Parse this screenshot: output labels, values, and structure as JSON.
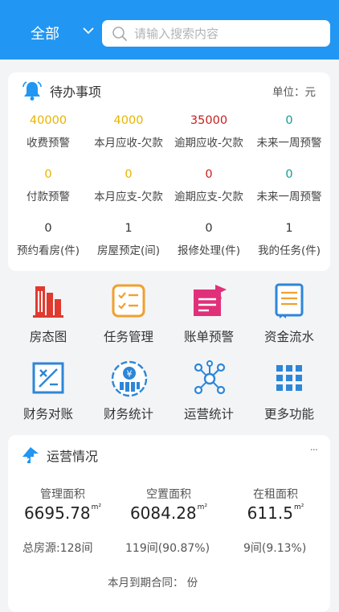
{
  "header": {
    "scope_label": "全部",
    "search_placeholder": "请输入搜索内容"
  },
  "todo": {
    "title": "待办事项",
    "unit": "单位：元",
    "items": [
      {
        "value": "40000",
        "label": "收费预警",
        "color": "#e7b400"
      },
      {
        "value": "4000",
        "label": "本月应收-欠款",
        "color": "#e7b400"
      },
      {
        "value": "35000",
        "label": "逾期应收-欠款",
        "color": "#c81e1e"
      },
      {
        "value": "0",
        "label": "未来一周预警",
        "color": "#139e8e"
      },
      {
        "value": "0",
        "label": "付款预警",
        "color": "#e7b400"
      },
      {
        "value": "0",
        "label": "本月应支-欠款",
        "color": "#e7b400"
      },
      {
        "value": "0",
        "label": "逾期应支-欠款",
        "color": "#c81e1e"
      },
      {
        "value": "0",
        "label": "未来一周预警",
        "color": "#139e8e"
      },
      {
        "value": "0",
        "label": "预约看房(件)",
        "color": "#333333"
      },
      {
        "value": "1",
        "label": "房屋预定(间)",
        "color": "#333333"
      },
      {
        "value": "0",
        "label": "报修处理(件)",
        "color": "#333333"
      },
      {
        "value": "1",
        "label": "我的任务(件)",
        "color": "#333333"
      }
    ]
  },
  "shortcuts": [
    {
      "label": "房态图",
      "icon": "building-icon"
    },
    {
      "label": "任务管理",
      "icon": "task-list-icon"
    },
    {
      "label": "账单预警",
      "icon": "bill-alert-icon"
    },
    {
      "label": "资金流水",
      "icon": "ledger-icon"
    },
    {
      "label": "财务对账",
      "icon": "reconcile-icon"
    },
    {
      "label": "财务统计",
      "icon": "finance-stats-icon"
    },
    {
      "label": "运营统计",
      "icon": "network-icon"
    },
    {
      "label": "更多功能",
      "icon": "grid-icon"
    }
  ],
  "operations": {
    "title": "运营情况",
    "more": "···",
    "metrics": [
      {
        "label": "管理面积",
        "value": "6695.78",
        "unit": "m²"
      },
      {
        "label": "空置面积",
        "value": "6084.28",
        "unit": "m²"
      },
      {
        "label": "在租面积",
        "value": "611.5",
        "unit": "m²"
      }
    ],
    "sub": [
      "总房源:128间",
      "119间(90.87%)",
      "9间(9.13%)"
    ],
    "contracts_label": "本月到期合同：  份"
  },
  "colors": {
    "brand_blue": "#2196f3",
    "red": "#e03a2f",
    "orange": "#f0a030",
    "pink": "#e0307a"
  }
}
